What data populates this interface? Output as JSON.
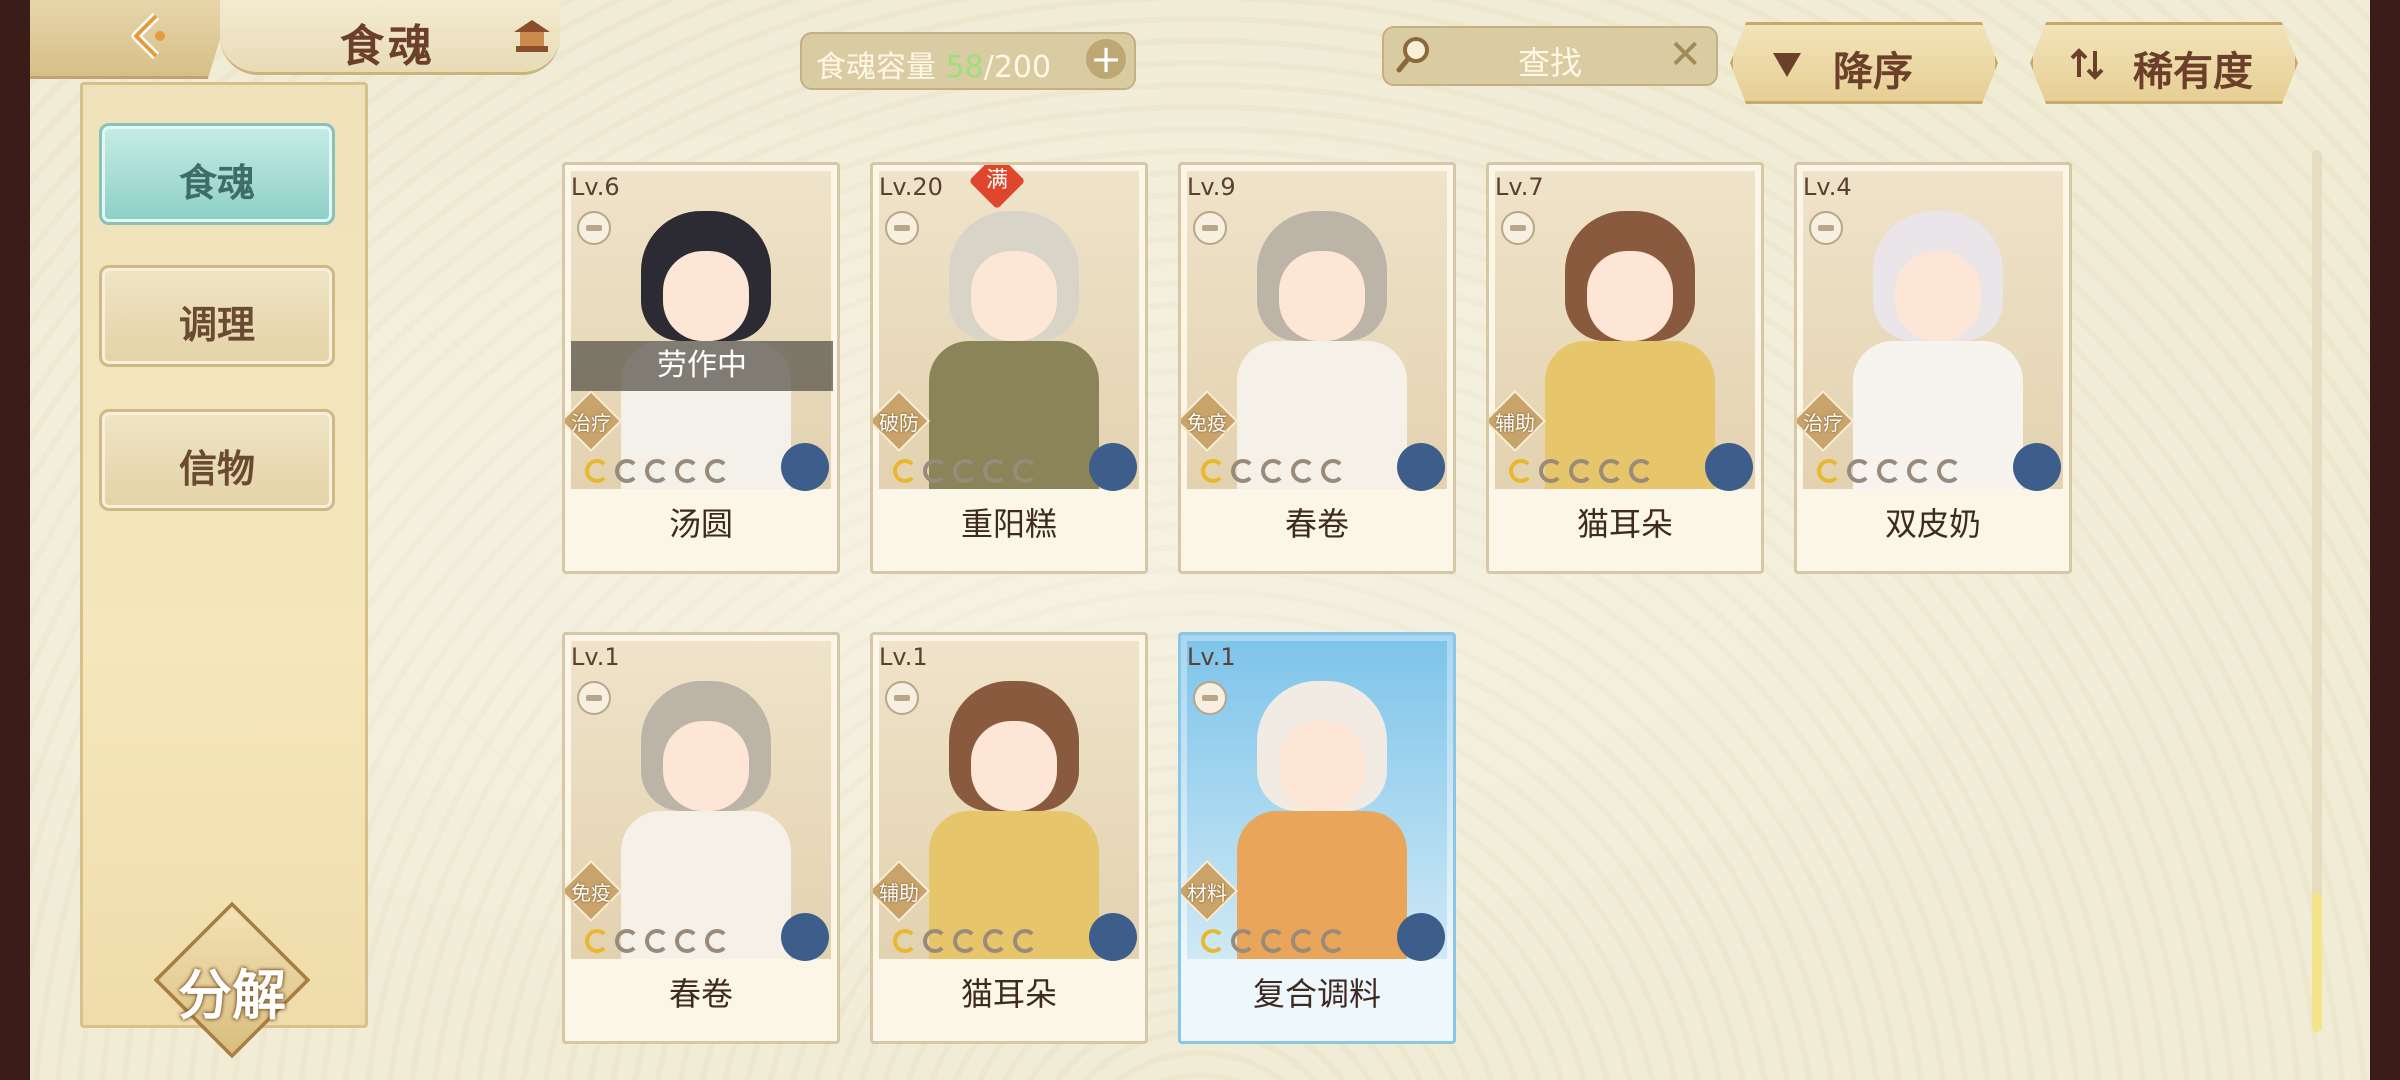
{
  "header": {
    "title": "食魂",
    "capacity_label": "食魂容量",
    "capacity_current": "58",
    "capacity_max": "/200",
    "search_placeholder": "查找",
    "sort_order_label": "降序",
    "sort_key_label": "稀有度"
  },
  "sidebar": {
    "items": [
      {
        "label": "食魂",
        "active": true
      },
      {
        "label": "调理",
        "active": false
      },
      {
        "label": "信物",
        "active": false
      }
    ],
    "decompose_label": "分解"
  },
  "cards": [
    {
      "level": "Lv.6",
      "name": "汤圆",
      "role": "治疗",
      "busy": "劳作中",
      "full": "",
      "gold_stars": 1,
      "total_stars": 5,
      "hair": "#2c2a33",
      "outfit": "#f4f0ea"
    },
    {
      "level": "Lv.20",
      "name": "重阳糕",
      "role": "破防",
      "busy": "",
      "full": "满",
      "gold_stars": 1,
      "total_stars": 5,
      "hair": "#d9d4c8",
      "outfit": "#8a8458"
    },
    {
      "level": "Lv.9",
      "name": "春卷",
      "role": "免疫",
      "busy": "",
      "full": "",
      "gold_stars": 1,
      "total_stars": 5,
      "hair": "#bdb4a8",
      "outfit": "#f6f1e8"
    },
    {
      "level": "Lv.7",
      "name": "猫耳朵",
      "role": "辅助",
      "busy": "",
      "full": "",
      "gold_stars": 1,
      "total_stars": 5,
      "hair": "#8a5a3e",
      "outfit": "#e7c56a"
    },
    {
      "level": "Lv.4",
      "name": "双皮奶",
      "role": "治疗",
      "busy": "",
      "full": "",
      "gold_stars": 1,
      "total_stars": 5,
      "hair": "#e9e5e8",
      "outfit": "#f7f3ee"
    },
    {
      "level": "Lv.1",
      "name": "春卷",
      "role": "免疫",
      "busy": "",
      "full": "",
      "gold_stars": 1,
      "total_stars": 5,
      "hair": "#bdb4a8",
      "outfit": "#f6f1e8"
    },
    {
      "level": "Lv.1",
      "name": "猫耳朵",
      "role": "辅助",
      "busy": "",
      "full": "",
      "gold_stars": 1,
      "total_stars": 5,
      "hair": "#8a5a3e",
      "outfit": "#e7c56a"
    },
    {
      "level": "Lv.1",
      "name": "复合调料",
      "role": "材料",
      "busy": "",
      "full": "",
      "gold_stars": 1,
      "total_stars": 5,
      "hair": "#f1ebe3",
      "outfit": "#e9a65a",
      "special": true
    }
  ],
  "colors": {
    "background": "#f1ecd6",
    "accent_teal": "#8ccfc5",
    "text_brown": "#6b3f2a",
    "capacity_green": "#9be07c"
  },
  "icons": {
    "back": "chevron-left-icon",
    "title": "pavilion-icon",
    "capacity_add": "plus-icon",
    "search": "search-icon",
    "clear": "close-icon",
    "sort_order": "triangle-down-icon",
    "sort_key": "sort-arrows-icon"
  }
}
